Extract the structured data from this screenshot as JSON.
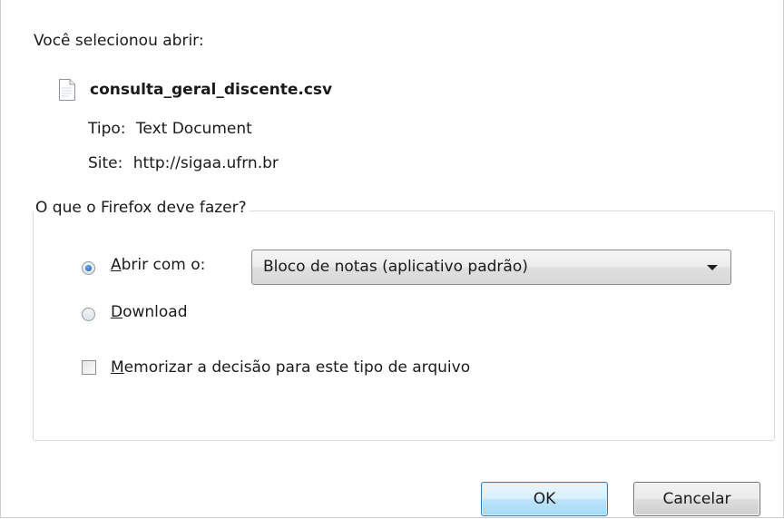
{
  "dialog": {
    "heading": "Você selecionou abrir:",
    "file": {
      "name": "consulta_geral_discente.csv",
      "icon": "text-file-icon"
    },
    "type_label": "Tipo:",
    "type_value": "Text Document",
    "site_label": "Site:",
    "site_value": "http://sigaa.ufrn.br"
  },
  "action_group": {
    "legend": "O que o Firefox deve fazer?",
    "open_with": {
      "mnemonic": "A",
      "rest": "brir com o:",
      "selected": true
    },
    "application_select": {
      "value": "Bloco de notas (aplicativo padrão)"
    },
    "download": {
      "mnemonic": "D",
      "rest": "ownload",
      "selected": false
    },
    "remember": {
      "mnemonic": "M",
      "rest": "emorizar a decisão para este tipo de arquivo",
      "checked": false
    }
  },
  "buttons": {
    "ok": "OK",
    "cancel": "Cancelar"
  }
}
